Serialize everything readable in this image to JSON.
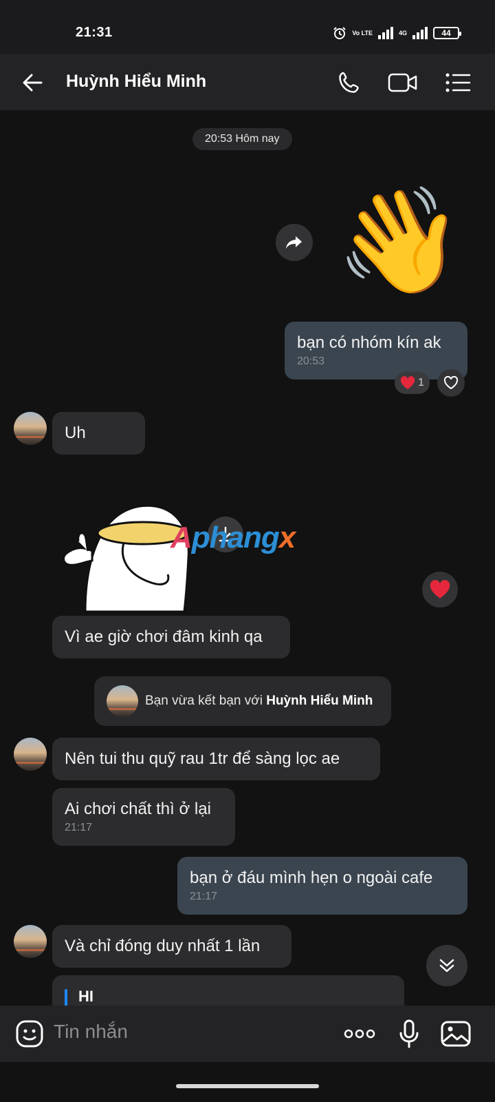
{
  "status_bar": {
    "time": "21:31",
    "network_label_1": "Vo LTE",
    "network_label_2": "4G",
    "battery": "44"
  },
  "header": {
    "contact_name": "Huỳnh Hiểu Minh",
    "icons": [
      "back-arrow-icon",
      "phone-icon",
      "video-camera-icon",
      "menu-list-icon"
    ]
  },
  "chat": {
    "date_separator": "20:53 Hôm nay",
    "wave_emoji": "👋",
    "messages": [
      {
        "side": "out",
        "text": "bạn có nhóm kín ak",
        "time": "20:53"
      },
      {
        "side": "in",
        "text": "Uh"
      },
      {
        "side": "in",
        "text": "Vì ae giờ chơi đâm kinh qa"
      },
      {
        "side": "in",
        "text": "Nên tui thu quỹ rau 1tr để sàng lọc ae"
      },
      {
        "side": "in",
        "text": "Ai chơi chất thì ở lại",
        "time": "21:17"
      },
      {
        "side": "out",
        "text": "bạn ở đáu mình hẹn o ngoài cafe",
        "time": "21:17"
      },
      {
        "side": "in",
        "text": "Và chỉ đóng duy nhất 1 lần"
      }
    ],
    "reaction_count": "1",
    "system_note": {
      "prefix": "Bạn vừa kết bạn với",
      "name": "Huỳnh Hiểu Minh"
    },
    "quote_text": "HI",
    "watermark": {
      "part1": "A",
      "part2": "phang",
      "part3": "x"
    }
  },
  "composer": {
    "placeholder": "Tin nhắn",
    "icons": [
      "sticker-icon",
      "more-dots-icon",
      "microphone-icon",
      "image-gallery-icon"
    ]
  },
  "colors": {
    "background": "#121212",
    "bar": "#232325",
    "bubble_in": "#2c2c2e",
    "bubble_out": "#3b4550",
    "heart": "#e6283c",
    "quote_accent": "#1e88ff"
  }
}
